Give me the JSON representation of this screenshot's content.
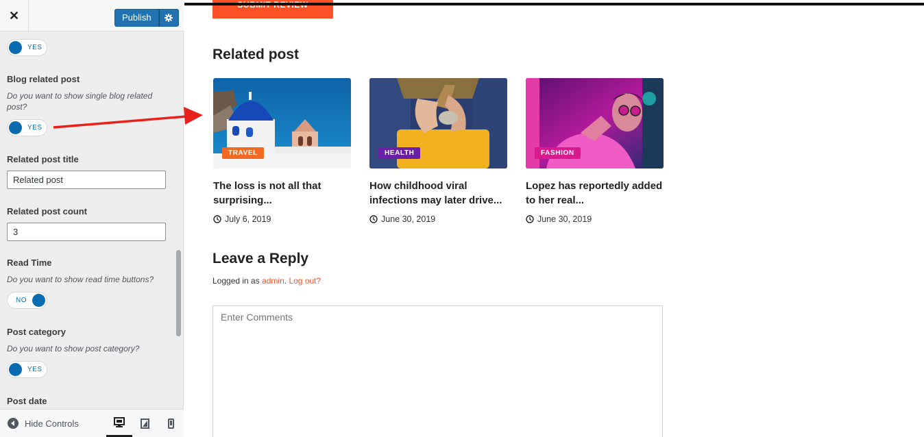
{
  "sidebar": {
    "close_label": "✕",
    "publish_label": "Publish",
    "toggle_top": "YES",
    "blog_related": {
      "title": "Blog related post",
      "desc": "Do you want to show single blog related post?",
      "toggle": "YES"
    },
    "related_title": {
      "title": "Related post title",
      "value": "Related post"
    },
    "related_count": {
      "title": "Related post count",
      "value": "3"
    },
    "read_time": {
      "title": "Read Time",
      "desc": "Do you want to show read time buttons?",
      "toggle": "NO"
    },
    "post_category": {
      "title": "Post category",
      "desc": "Do you want to show post category?",
      "toggle": "YES"
    },
    "post_date": {
      "title": "Post date"
    },
    "footer": {
      "hide_controls": "Hide Controls",
      "devices": [
        "desktop-icon",
        "tablet-icon",
        "mobile-icon"
      ],
      "active_device": "desktop"
    }
  },
  "preview": {
    "submit_review": "SUBMIT REVIEW",
    "related_heading": "Related post",
    "posts": [
      {
        "category": "TRAVEL",
        "category_color": "#f26a21",
        "title": "The loss is not all that surprising...",
        "date": "July 6, 2019"
      },
      {
        "category": "HEALTH",
        "category_color": "#6b1fa6",
        "title": "How childhood viral infections may later drive...",
        "date": "June 30, 2019"
      },
      {
        "category": "FASHION",
        "category_color": "#d81b8c",
        "title": "Lopez has reportedly added to her real...",
        "date": "June 30, 2019"
      }
    ],
    "reply_heading": "Leave a Reply",
    "logged_in_prefix": "Logged in as",
    "logged_in_user": "admin",
    "logged_in_sep": ".",
    "logout_label": "Log out?",
    "comment_placeholder": "Enter Comments"
  },
  "colors": {
    "accent": "#fc5125",
    "wp_blue": "#2271b1",
    "toggle_blue": "#0b6bb1",
    "annotation_arrow": "#e8221b"
  }
}
